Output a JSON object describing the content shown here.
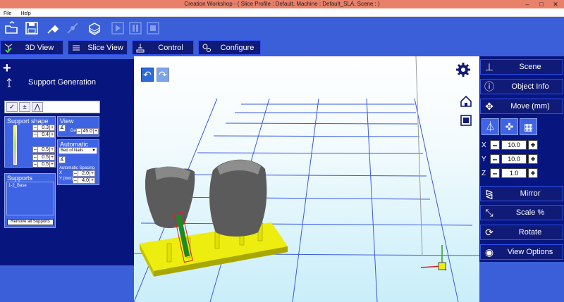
{
  "window": {
    "title": "Creation Workshop -  ( Slice Profile : Default, Machine : Default_SLA, Scene : )"
  },
  "menu": [
    "File",
    "Help"
  ],
  "toolbar": {
    "icons": [
      "open-icon",
      "save-icon",
      "connect-icon",
      "disconnect-icon",
      "slice-icon",
      "play-icon",
      "pause-icon",
      "stop-icon"
    ]
  },
  "tabs": [
    {
      "label": "3D View",
      "icon": "3d-view-icon"
    },
    {
      "label": "Slice View",
      "icon": "slice-view-icon"
    },
    {
      "label": "Control",
      "icon": "control-icon"
    },
    {
      "label": "Configure",
      "icon": "configure-icon"
    }
  ],
  "left": {
    "add": "+",
    "title": "Support Generation",
    "support_shape": {
      "header": "Support shape",
      "values": [
        "0.3",
        "0.4",
        "0.5",
        "0.5",
        "0.5"
      ]
    },
    "view": {
      "header": "View",
      "deg_label": "Deg",
      "deg_value": "45.0"
    },
    "automatic": {
      "header": "Automatic",
      "mode": "Bed of Nails",
      "spacing_label": "Automatic Spacing",
      "x_label": "X",
      "y_label": "Y (mm)",
      "x_value": "2.0",
      "y_value": "4.0"
    },
    "supports": {
      "header": "Supports",
      "items": [
        "1-2_Base"
      ],
      "remove_label": "Remove all Supports"
    }
  },
  "right": {
    "scene": "Scene",
    "object_info": "Object Info",
    "move": "Move (mm)",
    "x_label": "X",
    "y_label": "Y",
    "z_label": "Z",
    "x_value": "10.0",
    "y_value": "10.0",
    "z_value": "1.0",
    "mirror": "Mirror",
    "scale": "Scale %",
    "rotate": "Rotate",
    "view_options": "View Options"
  },
  "colors": {
    "panel": "#07157e",
    "accent": "#3a5fd9",
    "titlebar": "#e8806a",
    "base": "#e6e600"
  }
}
